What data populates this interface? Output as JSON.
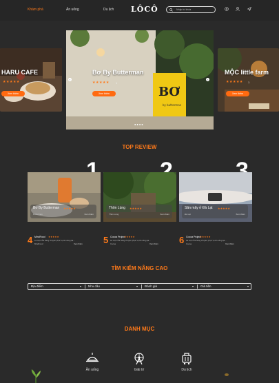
{
  "nav": {
    "items": [
      "Khám phá",
      "Ăn uống",
      "Du lịch"
    ],
    "logo": "LÔCÔ",
    "search_placeholder": "Nhập từ khóa"
  },
  "slider": {
    "left": {
      "title": "HARU CAFE",
      "button": "Xem thêm"
    },
    "center": {
      "title": "Bơ By Butterman",
      "count": "1",
      "button": "Xem thêm",
      "sign_text": "BƠ",
      "sign_sub": "by butterman"
    },
    "right": {
      "title": "MỘC little farm",
      "count": "1",
      "button": "Xem thêm"
    }
  },
  "top_review": {
    "title": "TOP REVIEW",
    "cards": [
      {
        "rank": "1",
        "name": "Bơ By Butterman",
        "meta": "Butterman",
        "more": "Xem thêm"
      },
      {
        "rank": "2",
        "name": "Thôn Lùng",
        "meta": "Thôn Lùng",
        "more": "Xem thêm"
      },
      {
        "rank": "3",
        "name": "Săn mây ở Đà Lạt",
        "meta": "Đà Lạt",
        "more": "Xem thêm"
      }
    ],
    "list": [
      {
        "rank": "4",
        "name": "MindFood",
        "desc": "Là một cửa hàng chuyên phục vụ ăn uống tại...",
        "meta": "MindFood",
        "more": "Xem thêm"
      },
      {
        "rank": "5",
        "name": "Cocoa Project",
        "desc": "Là một cửa hàng chuyên phục vụ ăn uống tại...",
        "meta": "Cocoa",
        "more": "Xem thêm"
      },
      {
        "rank": "6",
        "name": "Cocoa Project",
        "desc": "Là một cửa hàng chuyên phục vụ ăn uống tại...",
        "meta": "Cocoa",
        "more": "Xem thêm"
      }
    ]
  },
  "advanced_search": {
    "title": "TÌM KIẾM NÂNG CAO",
    "filters": [
      "Địa điểm",
      "Nhu cầu",
      "Đánh giá",
      "Giá tiền"
    ]
  },
  "categories": {
    "title": "DANH MỤC",
    "items": [
      {
        "label": "Ăn uống",
        "icon": "food-tray-icon"
      },
      {
        "label": "Giải trí",
        "icon": "ferris-wheel-icon"
      },
      {
        "label": "Du lịch",
        "icon": "luggage-icon"
      }
    ]
  },
  "colors": {
    "accent": "#ff7a1a",
    "background": "#2a2a2a",
    "nav": "#262626"
  }
}
